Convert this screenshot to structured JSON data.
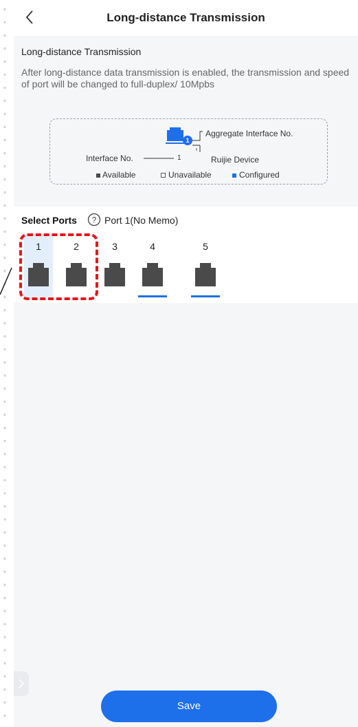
{
  "header": {
    "title": "Long-distance Transmission",
    "back_icon": "chevron-left-icon"
  },
  "info": {
    "section_title": "Long-distance Transmission",
    "description": "After long-distance data transmission is enabled, the transmission and speed of port will be changed to full-duplex/ 10Mpbs"
  },
  "legend": {
    "aggregate_label": "Aggregate Interface No.",
    "interface_label": "Interface No.",
    "interface_number": "1",
    "aggregate_badge": "1",
    "device_label": "Ruijie Device",
    "available": "Available",
    "unavailable": "Unavailable",
    "configured": "Configured",
    "colors": {
      "available": "#4a4a4a",
      "unavailable": "#ffffff",
      "configured": "#1d6fea"
    }
  },
  "select_ports": {
    "label": "Select Ports",
    "help_icon": "question-circle-icon",
    "port_info": "Port 1(No Memo)",
    "ports": [
      {
        "number": "1",
        "selected": true,
        "configured": false
      },
      {
        "number": "2",
        "selected": false,
        "configured": false
      },
      {
        "number": "3",
        "selected": false,
        "configured": false
      },
      {
        "number": "4",
        "selected": false,
        "configured": true
      },
      {
        "number": "5",
        "selected": false,
        "configured": true
      }
    ]
  },
  "save_button": {
    "label": "Save"
  },
  "colors": {
    "accent": "#1d6fea",
    "annotation": "#e8141b",
    "port_fill": "#4a4a4a"
  }
}
